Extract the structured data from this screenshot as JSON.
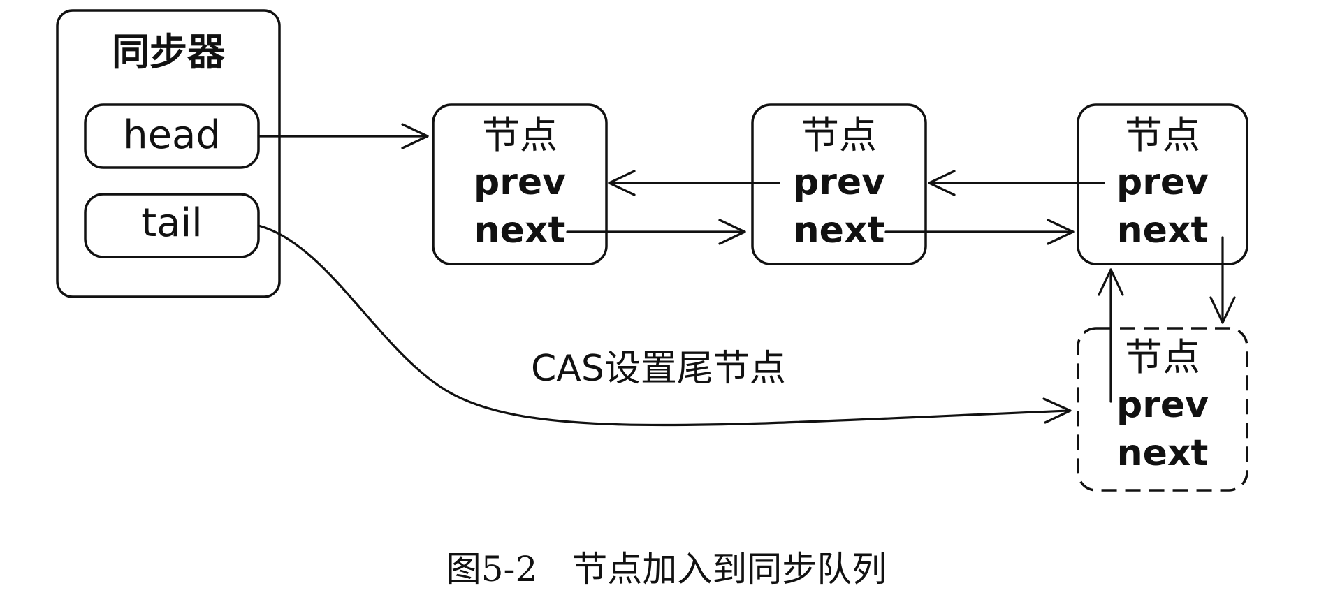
{
  "synchronizer": {
    "title": "同步器",
    "head_label": "head",
    "tail_label": "tail"
  },
  "nodes": [
    {
      "title": "节点",
      "prev": "prev",
      "next": "next",
      "style": "solid"
    },
    {
      "title": "节点",
      "prev": "prev",
      "next": "next",
      "style": "solid"
    },
    {
      "title": "节点",
      "prev": "prev",
      "next": "next",
      "style": "solid"
    },
    {
      "title": "节点",
      "prev": "prev",
      "next": "next",
      "style": "dashed"
    }
  ],
  "edge_label": "CAS设置尾节点",
  "caption": "图5-2　节点加入到同步队列"
}
